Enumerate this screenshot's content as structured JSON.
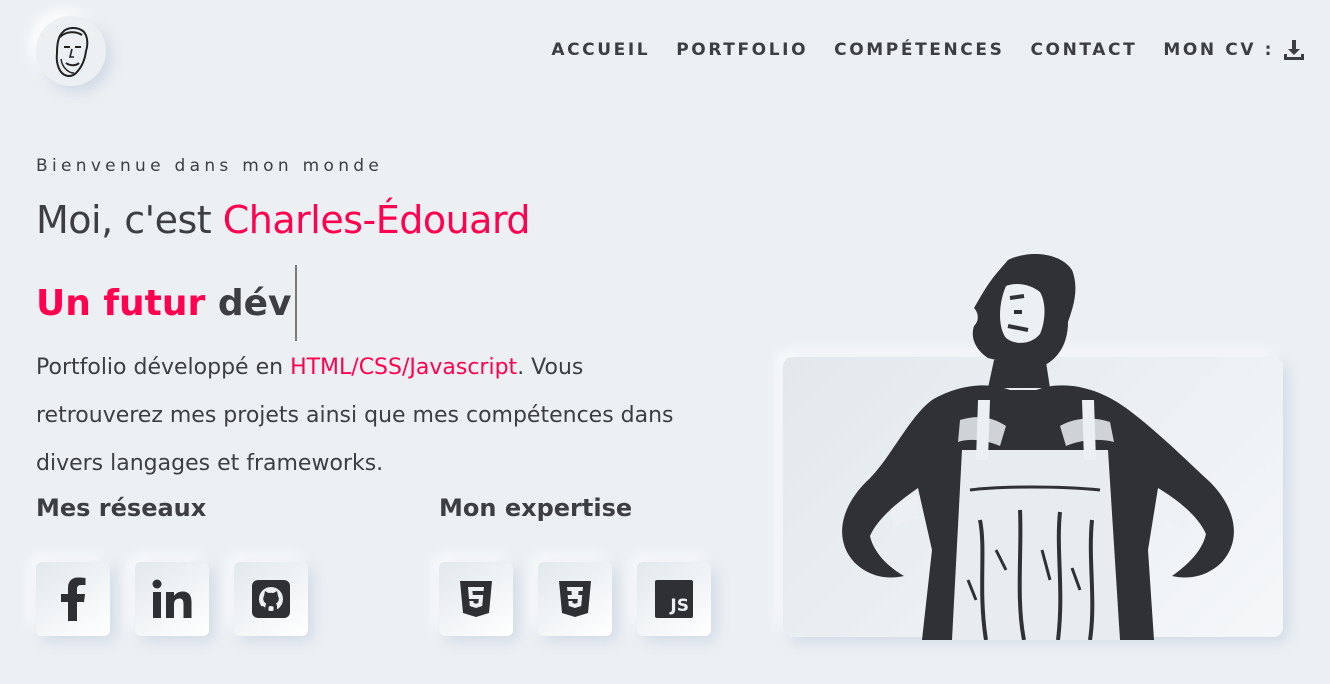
{
  "nav": {
    "items": [
      {
        "label": "ACCUEIL"
      },
      {
        "label": "PORTFOLIO"
      },
      {
        "label": "COMPÉTENCES"
      },
      {
        "label": "CONTACT"
      }
    ],
    "cv_label": "MON CV :",
    "cv_icon": "download-icon"
  },
  "logo": {
    "icon": "face-sketch-logo"
  },
  "hero": {
    "welcome": "Bienvenue dans mon monde",
    "title_prefix": "Moi, c'est ",
    "title_name": "Charles-Édouard",
    "typed_prefix": "Un futur",
    "typed_word": "dév",
    "description_before": "Portfolio développé en ",
    "description_tech": "HTML/CSS/Javascript",
    "description_after": ". Vous retrouverez mes projets ainsi que mes compétences dans divers langages et frameworks."
  },
  "networks": {
    "title": "Mes réseaux",
    "items": [
      {
        "icon": "facebook-icon"
      },
      {
        "icon": "linkedin-icon"
      },
      {
        "icon": "github-icon"
      }
    ]
  },
  "expertise": {
    "title": "Mon expertise",
    "items": [
      {
        "icon": "html5-icon"
      },
      {
        "icon": "css3-icon"
      },
      {
        "icon": "javascript-icon",
        "badge": "JS"
      }
    ]
  },
  "colors": {
    "background": "#ecf0f3",
    "accent": "#ff014f",
    "text": "#3c3e41"
  }
}
